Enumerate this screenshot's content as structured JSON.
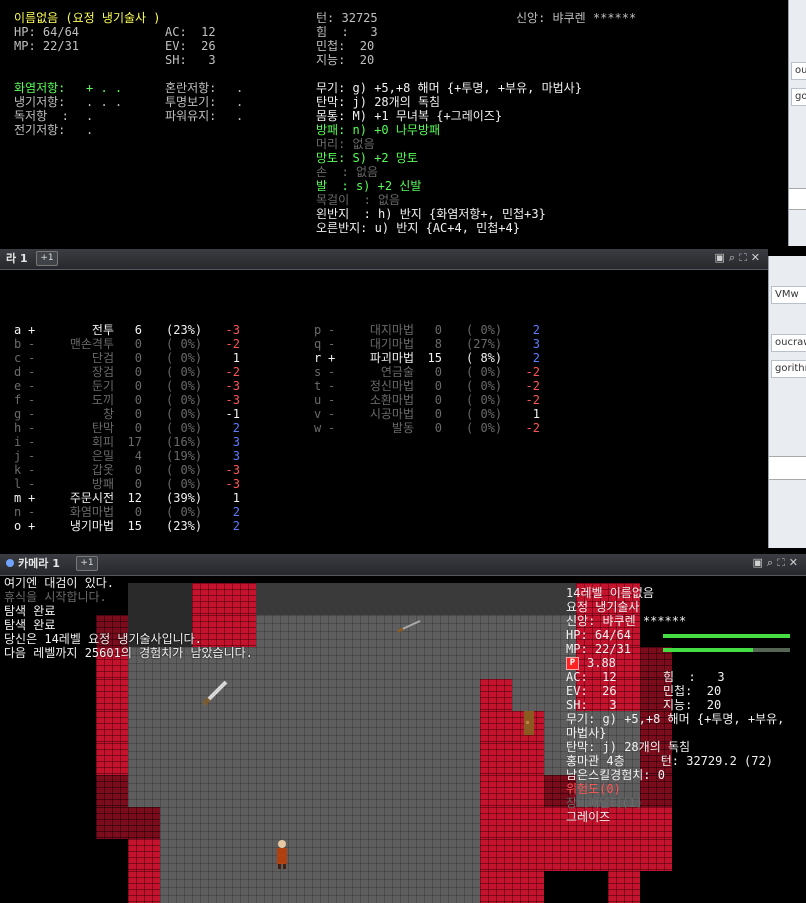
{
  "char": {
    "name_title": "이름없음 (요정 냉기술사 )",
    "hp": "HP: 64/64",
    "mp": "MP: 22/31",
    "ac": "AC:  12",
    "ev": "EV:  26",
    "sh": "SH:   3",
    "turn": "턴: 32725",
    "god": "신앙: 뱌쿠렌 ******",
    "str": "힘  :   3",
    "dex": "민첩:  20",
    "int": "지능:  20"
  },
  "resists": [
    {
      "label": "화염저항:",
      "val": "+ . .",
      "color": "green"
    },
    {
      "label": "냉기저항:",
      "val": ". . .",
      "color": "gray"
    },
    {
      "label": "독저항  :",
      "val": ".",
      "color": "gray"
    },
    {
      "label": "전기저항:",
      "val": ".",
      "color": "gray"
    }
  ],
  "resists2": [
    {
      "label": "혼란저항:",
      "val": "."
    },
    {
      "label": "투명보기:",
      "val": "."
    },
    {
      "label": "파워유지:",
      "val": "."
    }
  ],
  "equipment": [
    {
      "text": "무기: g) +5,+8 해머 {+투명, +부유, 마법사}",
      "color": "white"
    },
    {
      "text": "탄막: j) 28개의 독침",
      "color": "white"
    },
    {
      "text": "몸통: M) +1 무녀복 {+그레이즈}",
      "color": "white"
    },
    {
      "text": "방패: n) +0 나무방패",
      "color": "green"
    },
    {
      "text": "머리: 없음",
      "color": "dark"
    },
    {
      "text": "망토: S) +2 망토",
      "color": "green"
    },
    {
      "text": "손  : 없음",
      "color": "dark"
    },
    {
      "text": "발  : s) +2 신발",
      "color": "green"
    },
    {
      "text": "목걸이  : 없음",
      "color": "dark"
    },
    {
      "text": "왼반지  : h) 반지 {화염저항+, 민첩+3}",
      "color": "white"
    },
    {
      "text": "오른반지: u) 반지 {AC+4, 민첩+4}",
      "color": "white"
    }
  ],
  "panel1": {
    "title": "라 1",
    "plus": "+1"
  },
  "panel2": {
    "title": "카메라 1",
    "plus": "+1"
  },
  "skills_left": [
    {
      "key": "a",
      "mark": "+",
      "name": "전투",
      "lv": "6",
      "pct": "(23%)",
      "apt": "-3",
      "state": "on",
      "apt_color": "red"
    },
    {
      "key": "b",
      "mark": "-",
      "name": "맨손격투",
      "lv": "0",
      "pct": "( 0%)",
      "apt": "-2",
      "state": "off",
      "apt_color": "red"
    },
    {
      "key": "c",
      "mark": "-",
      "name": "단검",
      "lv": "0",
      "pct": "( 0%)",
      "apt": "1",
      "state": "off",
      "apt_color": "white"
    },
    {
      "key": "d",
      "mark": "-",
      "name": "장검",
      "lv": "0",
      "pct": "( 0%)",
      "apt": "-2",
      "state": "off",
      "apt_color": "red"
    },
    {
      "key": "e",
      "mark": "-",
      "name": "둔기",
      "lv": "0",
      "pct": "( 0%)",
      "apt": "-3",
      "state": "off",
      "apt_color": "red"
    },
    {
      "key": "f",
      "mark": "-",
      "name": "도끼",
      "lv": "0",
      "pct": "( 0%)",
      "apt": "-3",
      "state": "off",
      "apt_color": "red"
    },
    {
      "key": "g",
      "mark": "-",
      "name": "창",
      "lv": "0",
      "pct": "( 0%)",
      "apt": "-1",
      "state": "off",
      "apt_color": "white"
    },
    {
      "key": "h",
      "mark": "-",
      "name": "탄막",
      "lv": "0",
      "pct": "( 0%)",
      "apt": "2",
      "state": "off",
      "apt_color": "blue"
    },
    {
      "key": "i",
      "mark": "-",
      "name": "회피",
      "lv": "17",
      "pct": "(16%)",
      "apt": "3",
      "state": "off",
      "apt_color": "blue"
    },
    {
      "key": "j",
      "mark": "-",
      "name": "은밀",
      "lv": "4",
      "pct": "(19%)",
      "apt": "3",
      "state": "off",
      "apt_color": "blue"
    },
    {
      "key": "k",
      "mark": "-",
      "name": "갑옷",
      "lv": "0",
      "pct": "( 0%)",
      "apt": "-3",
      "state": "off",
      "apt_color": "red"
    },
    {
      "key": "l",
      "mark": "-",
      "name": "방패",
      "lv": "0",
      "pct": "( 0%)",
      "apt": "-3",
      "state": "off",
      "apt_color": "red"
    },
    {
      "key": "m",
      "mark": "+",
      "name": "주문시전",
      "lv": "12",
      "pct": "(39%)",
      "apt": "1",
      "state": "on",
      "apt_color": "white"
    },
    {
      "key": "n",
      "mark": "-",
      "name": "화염마법",
      "lv": "0",
      "pct": "( 0%)",
      "apt": "2",
      "state": "off",
      "apt_color": "blue"
    },
    {
      "key": "o",
      "mark": "+",
      "name": "냉기마법",
      "lv": "15",
      "pct": "(23%)",
      "apt": "2",
      "state": "on",
      "apt_color": "blue"
    }
  ],
  "skills_right": [
    {
      "key": "p",
      "mark": "-",
      "name": "대지마법",
      "lv": "0",
      "pct": "( 0%)",
      "apt": "2",
      "state": "off",
      "apt_color": "blue"
    },
    {
      "key": "q",
      "mark": "-",
      "name": "대기마법",
      "lv": "8",
      "pct": "(27%)",
      "apt": "3",
      "state": "off",
      "apt_color": "blue"
    },
    {
      "key": "r",
      "mark": "+",
      "name": "파괴마법",
      "lv": "15",
      "pct": "( 8%)",
      "apt": "2",
      "state": "on",
      "apt_color": "blue"
    },
    {
      "key": "s",
      "mark": "-",
      "name": "연금술",
      "lv": "0",
      "pct": "( 0%)",
      "apt": "-2",
      "state": "off",
      "apt_color": "red"
    },
    {
      "key": "t",
      "mark": "-",
      "name": "정신마법",
      "lv": "0",
      "pct": "( 0%)",
      "apt": "-2",
      "state": "off",
      "apt_color": "red"
    },
    {
      "key": "u",
      "mark": "-",
      "name": "소환마법",
      "lv": "0",
      "pct": "( 0%)",
      "apt": "-2",
      "state": "off",
      "apt_color": "red"
    },
    {
      "key": "v",
      "mark": "-",
      "name": "시공마법",
      "lv": "0",
      "pct": "( 0%)",
      "apt": "1",
      "state": "off",
      "apt_color": "white"
    },
    {
      "key": "w",
      "mark": "-",
      "name": "발동",
      "lv": "0",
      "pct": "( 0%)",
      "apt": "-2",
      "state": "off",
      "apt_color": "red"
    }
  ],
  "messages": [
    {
      "text": "여기엔 대검이 있다.",
      "color": "white"
    },
    {
      "text": "휴식을 시작합니다.",
      "color": "dark"
    },
    {
      "text": "탐색 완료",
      "color": "white"
    },
    {
      "text": "탐색 완료",
      "color": "white"
    },
    {
      "text": "당신은 14레벨 요정 냉기술사입니다.",
      "color": "white"
    },
    {
      "text": "다음 레벨까지 25601의 경험치가 남았습니다.",
      "color": "white"
    }
  ],
  "sidebar": {
    "line1": "14레벨 이름없음",
    "line2": "요정 냉기술사",
    "god": "신앙: 뱌쿠렌 ******",
    "hp": "HP: 64/64",
    "mp": "MP: 22/31",
    "p_badge": "P",
    "p_value": "3.88",
    "ac": "AC:  12",
    "str": "힘  :   3",
    "ev": "EV:  26",
    "dex": "민첩:  20",
    "sh": "SH:   3",
    "int": "지능:  20",
    "weapon": "무기: g) +5,+8 해머 {+투명, +부유,",
    "weapon2": "마법사}",
    "ammo": "탄막: j) 28개의 독침",
    "place": "홍마관 4층     턴: 32729.2 (72)",
    "skillxp": "남은스킬경험치: 0",
    "danger": "위험도(0)",
    "penalty": "장비패널티(1)",
    "graze": "그레이즈",
    "hp_fill": 1.0,
    "mp_fill": 0.71
  },
  "side": {
    "tab1": "oucr",
    "tab2": "gori",
    "tab3": "VMw",
    "tab4": "oucraw",
    "tab5": "gorithm"
  },
  "colors": {
    "green": "#55ff55",
    "red": "#ff5555",
    "blue": "#5f7bff",
    "wall": "#c4132d"
  }
}
